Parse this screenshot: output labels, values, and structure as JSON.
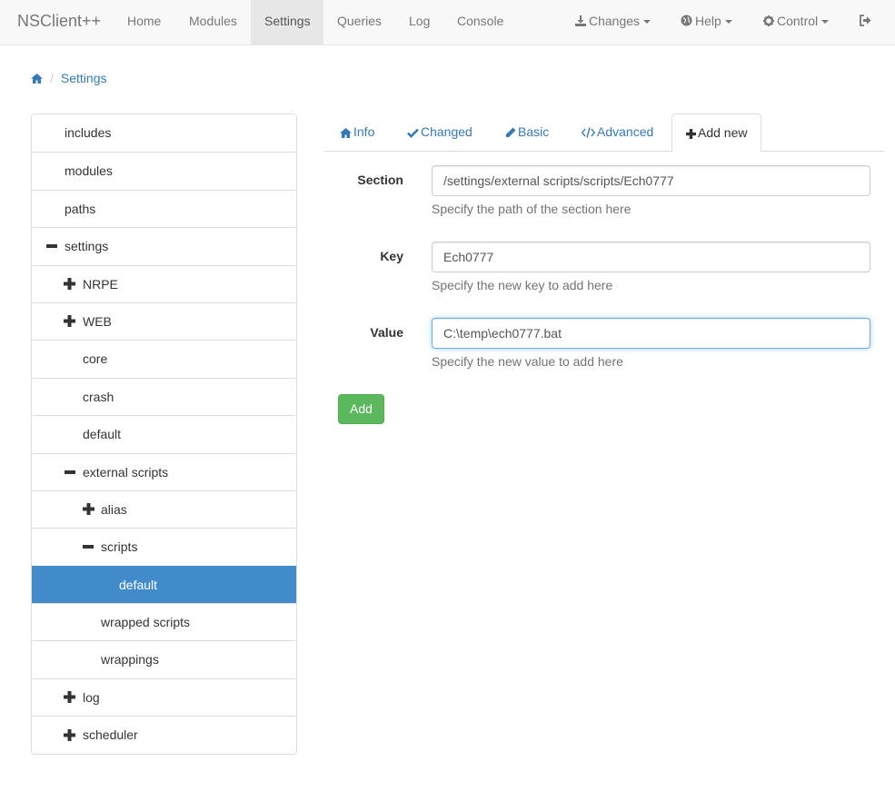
{
  "navbar": {
    "brand": "NSClient++",
    "items": [
      {
        "label": "Home"
      },
      {
        "label": "Modules"
      },
      {
        "label": "Settings"
      },
      {
        "label": "Queries"
      },
      {
        "label": "Log"
      },
      {
        "label": "Console"
      }
    ],
    "right": [
      {
        "label": "Changes",
        "icon": "download-icon"
      },
      {
        "label": "Help",
        "icon": "globe-icon"
      },
      {
        "label": "Control",
        "icon": "gear-icon"
      }
    ],
    "logout_icon": "sign-out-icon"
  },
  "breadcrumb": {
    "home_icon": "home-icon",
    "current": "Settings"
  },
  "tree": [
    {
      "label": "includes",
      "toggle": ""
    },
    {
      "label": "modules",
      "toggle": ""
    },
    {
      "label": "paths",
      "toggle": ""
    },
    {
      "label": "settings",
      "toggle": "minus"
    },
    {
      "label": "NRPE",
      "toggle": "plus"
    },
    {
      "label": "WEB",
      "toggle": "plus"
    },
    {
      "label": "core",
      "toggle": ""
    },
    {
      "label": "crash",
      "toggle": ""
    },
    {
      "label": "default",
      "toggle": ""
    },
    {
      "label": "external scripts",
      "toggle": "minus"
    },
    {
      "label": "alias",
      "toggle": "plus"
    },
    {
      "label": "scripts",
      "toggle": "minus"
    },
    {
      "label": "default",
      "toggle": "",
      "selected": true
    },
    {
      "label": "wrapped scripts",
      "toggle": ""
    },
    {
      "label": "wrappings",
      "toggle": ""
    },
    {
      "label": "log",
      "toggle": "plus"
    },
    {
      "label": "scheduler",
      "toggle": "plus"
    }
  ],
  "tabs": [
    {
      "label": "Info",
      "icon": "home-icon"
    },
    {
      "label": "Changed",
      "icon": "check-icon"
    },
    {
      "label": "Basic",
      "icon": "pencil-icon"
    },
    {
      "label": "Advanced",
      "icon": "code-icon"
    },
    {
      "label": "Add new",
      "icon": "plus-icon",
      "active": true
    }
  ],
  "form": {
    "section": {
      "label": "Section",
      "value": "/settings/external scripts/scripts/Ech0777",
      "help": "Specify the path of the section here"
    },
    "key": {
      "label": "Key",
      "value": "Ech0777",
      "help": "Specify the new key to add here"
    },
    "value": {
      "label": "Value",
      "value": "C:\\temp\\ech0777.bat",
      "help": "Specify the new value to add here"
    },
    "add_button": "Add"
  },
  "colors": {
    "link": "#337ab7",
    "active_item": "#428bca",
    "success_button": "#5cb85c",
    "navbar_bg": "#f8f8f8"
  }
}
